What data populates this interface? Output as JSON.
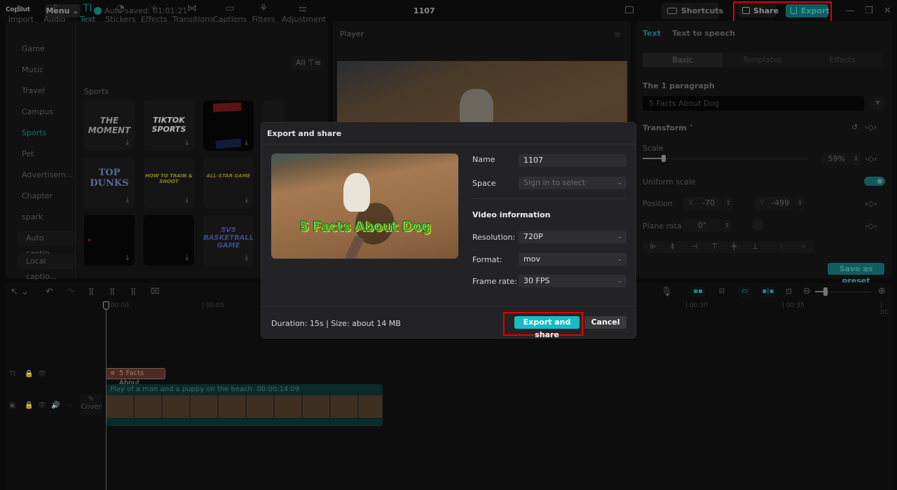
{
  "titlebar": {
    "app_name": "CopCut",
    "menu_label": "Menu ⌄",
    "autosave": "Auto saved: 01:01:21",
    "project_title": "1107",
    "shortcuts_label": "Shortcuts",
    "share_label": "Share",
    "export_label": "Export",
    "minimize": "—",
    "restore": "❐",
    "close": "✕"
  },
  "toolbar": {
    "tools": [
      {
        "label": "Import",
        "glyph": "▶"
      },
      {
        "label": "Audio",
        "glyph": "♪"
      },
      {
        "label": "Text",
        "glyph": "TI"
      },
      {
        "label": "Stickers",
        "glyph": "◔"
      },
      {
        "label": "Effects",
        "glyph": "✧"
      },
      {
        "label": "Transitions",
        "glyph": "⋈"
      },
      {
        "label": "Captions",
        "glyph": "▭"
      },
      {
        "label": "Filters",
        "glyph": "⚘"
      },
      {
        "label": "Adjustment",
        "glyph": "⚌"
      }
    ]
  },
  "categories": {
    "items": [
      "Game",
      "Music",
      "Travel",
      "Campus",
      "Sports",
      "Pet",
      "Advertisem...",
      "Chapter",
      "spark"
    ],
    "active": "Sports",
    "buttons": [
      "Auto captio...",
      "Local captio..."
    ]
  },
  "library": {
    "filter_label": "All ⊤≡",
    "section_title": "Sports",
    "tiles": [
      {
        "text": "THE MOMENT",
        "color": "#8a8a8a"
      },
      {
        "text": "TIKTOK SPORTS",
        "color": "#b8b8b8"
      },
      {
        "text": "",
        "color": "#000"
      },
      {
        "text": "TOP DUNKS",
        "color": "#5a6a9a"
      },
      {
        "text": "HOW TO TRAIN & SHOOT",
        "color": "#aaa030"
      },
      {
        "text": "ALL-STAR GAME",
        "color": "#a08a20"
      },
      {
        "text": "",
        "color": "#000"
      },
      {
        "text": "",
        "color": "#000"
      },
      {
        "text": "5V5 BASKETBALL GAME",
        "color": "#3a4a8a"
      }
    ],
    "download_glyph": "⤓"
  },
  "player": {
    "title": "Player",
    "menu_glyph": "≡"
  },
  "inspector": {
    "tabs": [
      "Text",
      "Text to speech"
    ],
    "segments": [
      "Basic",
      "Templates",
      "Effects"
    ],
    "paragraph_label": "The 1 paragraph",
    "paragraph_value": "5 Facts About Dog",
    "transform_label": "Transform ˄",
    "scale_label": "Scale",
    "scale_value": "59%",
    "scale_fraction": 0.59,
    "uniform_scale_label": "Uniform scale",
    "uniform_scale_on": true,
    "position_label": "Position",
    "pos_x_label": "X",
    "pos_x": "-70",
    "pos_y_label": "Y",
    "pos_y": "-499",
    "rotation_label": "Plane rota...",
    "rotation_value": "0°",
    "keyframe_glyph": "‹◇›",
    "reset_glyph": "↺",
    "save_preset_label": "Save as preset"
  },
  "timeline": {
    "tools": [
      "↖ ⌄",
      "↶",
      "↷",
      "][",
      "][",
      "][",
      "🗑"
    ],
    "right_tools": [
      "🎙",
      "⇔",
      "⇳",
      "⇔",
      "⇔",
      "⊡",
      "⊖",
      "⊕"
    ],
    "ruler": [
      "00:00",
      "| 00:05",
      "| 00:30",
      "| 00:35",
      "| 0C"
    ],
    "text_clip_label": "5 Facts About",
    "video_clip_label": "Play of a man and a puppy on the beach",
    "video_clip_duration": "00:00:14:09",
    "cover_label": "Cover",
    "track_icons_text": [
      "TI",
      "🔒",
      "👁"
    ],
    "track_icons_video": [
      "▣",
      "🔒",
      "👁",
      "🔊",
      "⋯"
    ]
  },
  "modal": {
    "title": "Export and share",
    "thumbnail_caption": "5 Facts About Dog",
    "name_label": "Name",
    "name_value": "1107",
    "space_label": "Space",
    "space_placeholder": "Sign in to select",
    "video_info_title": "Video information",
    "resolution_label": "Resolution:",
    "resolution_value": "720P",
    "format_label": "Format:",
    "format_value": "mov",
    "frame_rate_label": "Frame rate:",
    "frame_rate_value": "30 FPS",
    "footer_info": "Duration: 15s | Size: about 14 MB",
    "export_share_label": "Export and share",
    "cancel_label": "Cancel",
    "chevron": "⌄"
  }
}
